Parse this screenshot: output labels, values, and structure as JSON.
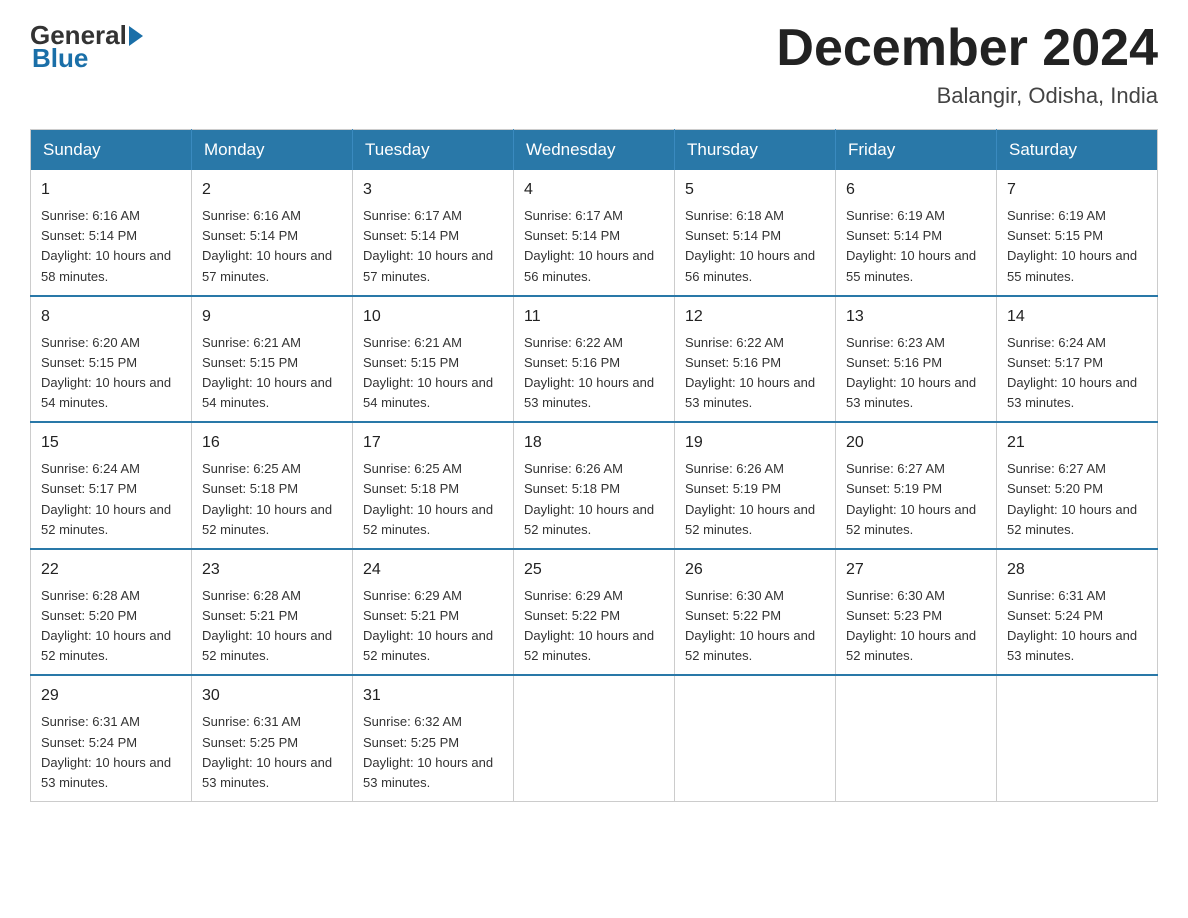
{
  "header": {
    "logo_general": "General",
    "logo_blue": "Blue",
    "month_title": "December 2024",
    "location": "Balangir, Odisha, India"
  },
  "days_of_week": [
    "Sunday",
    "Monday",
    "Tuesday",
    "Wednesday",
    "Thursday",
    "Friday",
    "Saturday"
  ],
  "weeks": [
    [
      {
        "day": "1",
        "sunrise": "6:16 AM",
        "sunset": "5:14 PM",
        "daylight": "10 hours and 58 minutes."
      },
      {
        "day": "2",
        "sunrise": "6:16 AM",
        "sunset": "5:14 PM",
        "daylight": "10 hours and 57 minutes."
      },
      {
        "day": "3",
        "sunrise": "6:17 AM",
        "sunset": "5:14 PM",
        "daylight": "10 hours and 57 minutes."
      },
      {
        "day": "4",
        "sunrise": "6:17 AM",
        "sunset": "5:14 PM",
        "daylight": "10 hours and 56 minutes."
      },
      {
        "day": "5",
        "sunrise": "6:18 AM",
        "sunset": "5:14 PM",
        "daylight": "10 hours and 56 minutes."
      },
      {
        "day": "6",
        "sunrise": "6:19 AM",
        "sunset": "5:14 PM",
        "daylight": "10 hours and 55 minutes."
      },
      {
        "day": "7",
        "sunrise": "6:19 AM",
        "sunset": "5:15 PM",
        "daylight": "10 hours and 55 minutes."
      }
    ],
    [
      {
        "day": "8",
        "sunrise": "6:20 AM",
        "sunset": "5:15 PM",
        "daylight": "10 hours and 54 minutes."
      },
      {
        "day": "9",
        "sunrise": "6:21 AM",
        "sunset": "5:15 PM",
        "daylight": "10 hours and 54 minutes."
      },
      {
        "day": "10",
        "sunrise": "6:21 AM",
        "sunset": "5:15 PM",
        "daylight": "10 hours and 54 minutes."
      },
      {
        "day": "11",
        "sunrise": "6:22 AM",
        "sunset": "5:16 PM",
        "daylight": "10 hours and 53 minutes."
      },
      {
        "day": "12",
        "sunrise": "6:22 AM",
        "sunset": "5:16 PM",
        "daylight": "10 hours and 53 minutes."
      },
      {
        "day": "13",
        "sunrise": "6:23 AM",
        "sunset": "5:16 PM",
        "daylight": "10 hours and 53 minutes."
      },
      {
        "day": "14",
        "sunrise": "6:24 AM",
        "sunset": "5:17 PM",
        "daylight": "10 hours and 53 minutes."
      }
    ],
    [
      {
        "day": "15",
        "sunrise": "6:24 AM",
        "sunset": "5:17 PM",
        "daylight": "10 hours and 52 minutes."
      },
      {
        "day": "16",
        "sunrise": "6:25 AM",
        "sunset": "5:18 PM",
        "daylight": "10 hours and 52 minutes."
      },
      {
        "day": "17",
        "sunrise": "6:25 AM",
        "sunset": "5:18 PM",
        "daylight": "10 hours and 52 minutes."
      },
      {
        "day": "18",
        "sunrise": "6:26 AM",
        "sunset": "5:18 PM",
        "daylight": "10 hours and 52 minutes."
      },
      {
        "day": "19",
        "sunrise": "6:26 AM",
        "sunset": "5:19 PM",
        "daylight": "10 hours and 52 minutes."
      },
      {
        "day": "20",
        "sunrise": "6:27 AM",
        "sunset": "5:19 PM",
        "daylight": "10 hours and 52 minutes."
      },
      {
        "day": "21",
        "sunrise": "6:27 AM",
        "sunset": "5:20 PM",
        "daylight": "10 hours and 52 minutes."
      }
    ],
    [
      {
        "day": "22",
        "sunrise": "6:28 AM",
        "sunset": "5:20 PM",
        "daylight": "10 hours and 52 minutes."
      },
      {
        "day": "23",
        "sunrise": "6:28 AM",
        "sunset": "5:21 PM",
        "daylight": "10 hours and 52 minutes."
      },
      {
        "day": "24",
        "sunrise": "6:29 AM",
        "sunset": "5:21 PM",
        "daylight": "10 hours and 52 minutes."
      },
      {
        "day": "25",
        "sunrise": "6:29 AM",
        "sunset": "5:22 PM",
        "daylight": "10 hours and 52 minutes."
      },
      {
        "day": "26",
        "sunrise": "6:30 AM",
        "sunset": "5:22 PM",
        "daylight": "10 hours and 52 minutes."
      },
      {
        "day": "27",
        "sunrise": "6:30 AM",
        "sunset": "5:23 PM",
        "daylight": "10 hours and 52 minutes."
      },
      {
        "day": "28",
        "sunrise": "6:31 AM",
        "sunset": "5:24 PM",
        "daylight": "10 hours and 53 minutes."
      }
    ],
    [
      {
        "day": "29",
        "sunrise": "6:31 AM",
        "sunset": "5:24 PM",
        "daylight": "10 hours and 53 minutes."
      },
      {
        "day": "30",
        "sunrise": "6:31 AM",
        "sunset": "5:25 PM",
        "daylight": "10 hours and 53 minutes."
      },
      {
        "day": "31",
        "sunrise": "6:32 AM",
        "sunset": "5:25 PM",
        "daylight": "10 hours and 53 minutes."
      },
      null,
      null,
      null,
      null
    ]
  ],
  "labels": {
    "sunrise": "Sunrise:",
    "sunset": "Sunset:",
    "daylight": "Daylight:"
  }
}
